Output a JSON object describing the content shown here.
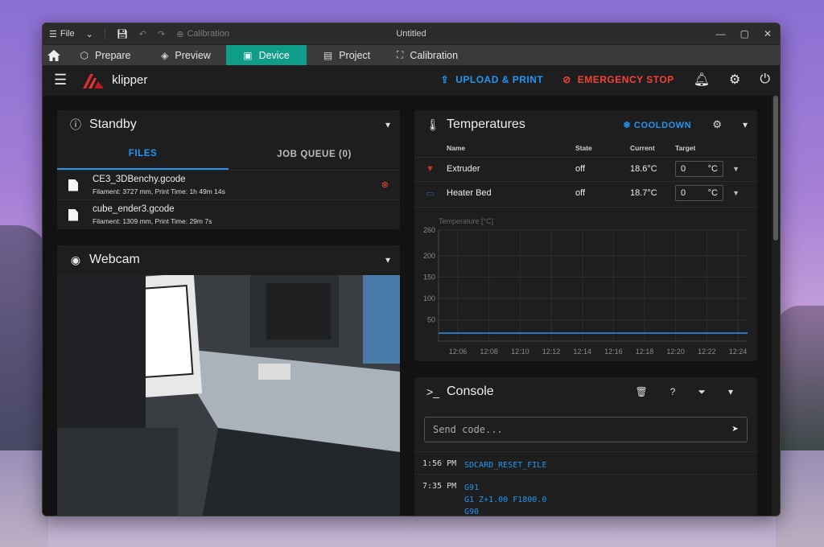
{
  "titlebar": {
    "menu_label": "File",
    "calibration_label": "Calibration",
    "title": "Untitled"
  },
  "tabs": [
    {
      "label": "Prepare"
    },
    {
      "label": "Preview"
    },
    {
      "label": "Device"
    },
    {
      "label": "Project"
    },
    {
      "label": "Calibration"
    }
  ],
  "appbar": {
    "brand": "klipper",
    "upload_label": "UPLOAD & PRINT",
    "estop_label": "EMERGENCY STOP"
  },
  "standby": {
    "title": "Standby",
    "tabs": [
      "FILES",
      "JOB QUEUE (0)"
    ],
    "files": [
      {
        "name": "CE3_3DBenchy.gcode",
        "meta": "Filament: 3727 mm, Print Time: 1h 49m 14s"
      },
      {
        "name": "cube_ender3.gcode",
        "meta": "Filament: 1309 mm, Print Time: 29m 7s"
      }
    ]
  },
  "webcam": {
    "title": "Webcam"
  },
  "temperatures": {
    "title": "Temperatures",
    "cooldown_label": "COOLDOWN",
    "headers": [
      "Name",
      "State",
      "Current",
      "Target"
    ],
    "rows": [
      {
        "name": "Extruder",
        "state": "off",
        "current": "18.6°C",
        "target": "0",
        "unit": "°C"
      },
      {
        "name": "Heater Bed",
        "state": "off",
        "current": "18.7°C",
        "target": "0",
        "unit": "°C"
      }
    ]
  },
  "chart_data": {
    "type": "line",
    "ylabel": "Temperature [°C]",
    "ylim": [
      0,
      260
    ],
    "yticks": [
      50,
      100,
      150,
      200,
      260
    ],
    "categories": [
      "12:06",
      "12:08",
      "12:10",
      "12:12",
      "12:14",
      "12:16",
      "12:18",
      "12:20",
      "12:22",
      "12:24"
    ],
    "series": [
      {
        "values": [
          18.6,
          18.6,
          18.6,
          18.6,
          18.6,
          18.6,
          18.6,
          18.6,
          18.6,
          18.6
        ],
        "color": "#2196f3"
      }
    ],
    "grid": true
  },
  "console": {
    "title": "Console",
    "placeholder": "Send code...",
    "entries": [
      {
        "time": "1:56 PM",
        "lines": "SDCARD_RESET_FILE"
      },
      {
        "time": "7:35 PM",
        "lines": "G91\nG1 Z+1.00 F1800.0\nG90"
      }
    ]
  },
  "colors": {
    "accent_teal": "#0f9d8a",
    "primary_blue": "#2196f3",
    "danger_red": "#f44336",
    "background": "#121212",
    "card": "#1e1e1e"
  }
}
